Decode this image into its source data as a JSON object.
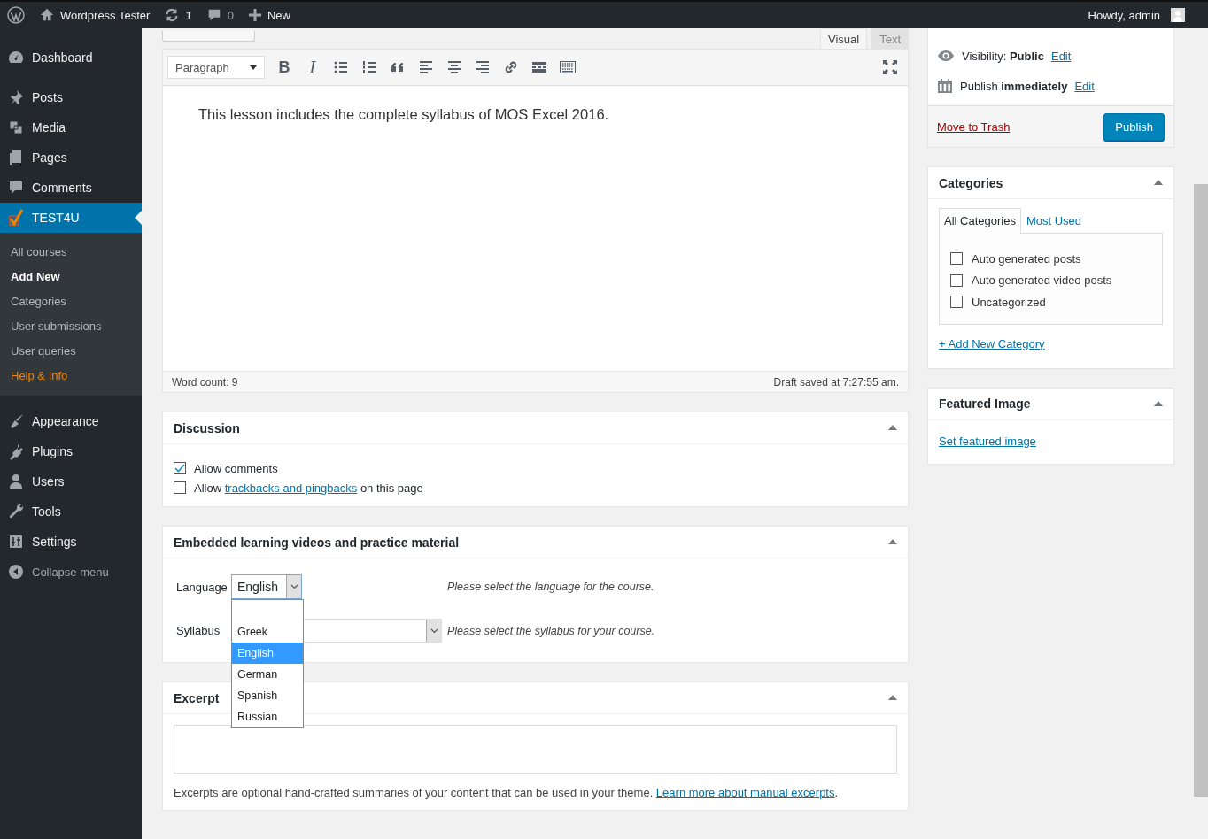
{
  "admin_bar": {
    "site": "Wordpress Tester",
    "updates": "1",
    "comments": "0",
    "new": "New",
    "greeting": "Howdy, admin"
  },
  "sidebar": {
    "items": [
      {
        "label": "Dashboard",
        "selected": false
      },
      {
        "label": "Posts",
        "selected": false
      },
      {
        "label": "Media",
        "selected": false
      },
      {
        "label": "Pages",
        "selected": false
      },
      {
        "label": "Comments",
        "selected": false
      },
      {
        "label": "TEST4U",
        "selected": true,
        "children": [
          {
            "label": "All courses",
            "kind": "link",
            "selected": false
          },
          {
            "label": "Add New",
            "kind": "link",
            "selected": true
          },
          {
            "label": "Categories",
            "kind": "link",
            "selected": false
          },
          {
            "label": "User submissions",
            "kind": "link",
            "selected": false
          },
          {
            "label": "User queries",
            "kind": "link",
            "selected": false
          },
          {
            "label": "Help & Info",
            "kind": "highlight",
            "selected": false
          }
        ]
      },
      {
        "label": "Appearance",
        "selected": false
      },
      {
        "label": "Plugins",
        "selected": false
      },
      {
        "label": "Users",
        "selected": false
      },
      {
        "label": "Tools",
        "selected": false
      },
      {
        "label": "Settings",
        "selected": false
      }
    ],
    "collapse": "Collapse menu"
  },
  "editor": {
    "tabs": [
      {
        "label": "Visual",
        "selected": true
      },
      {
        "label": "Text",
        "selected": false
      }
    ],
    "format": "Paragraph",
    "toolbar": [
      {
        "kind": "bold",
        "text": "B"
      },
      {
        "kind": "italic",
        "text": "I"
      },
      {
        "kind": "bullets"
      },
      {
        "kind": "numbers"
      },
      {
        "kind": "quote"
      },
      {
        "kind": "align-left"
      },
      {
        "kind": "align-center"
      },
      {
        "kind": "align-right"
      },
      {
        "kind": "link"
      },
      {
        "kind": "more"
      },
      {
        "kind": "keyboard"
      }
    ],
    "content": "This lesson includes the complete syllabus of MOS Excel 2016.",
    "word_count": "Word count: 9",
    "draft_status": "Draft saved at 7:27:55 am."
  },
  "discussion": {
    "title": "Discussion",
    "options": [
      {
        "before": "Allow comments",
        "checked": true
      },
      {
        "before": "Allow ",
        "link": "trackbacks and pingbacks",
        "after": " on this page",
        "checked": false
      }
    ]
  },
  "embedded": {
    "title": "Embedded learning videos and practice material",
    "language": {
      "label": "Language",
      "value": "English",
      "hint": "Please select the language for the course.",
      "expanded": true,
      "options": [
        {
          "label": "Greek",
          "selected": false
        },
        {
          "label": "English",
          "selected": true
        },
        {
          "label": "German",
          "selected": false
        },
        {
          "label": "Spanish",
          "selected": false
        },
        {
          "label": "Russian",
          "selected": false
        }
      ]
    },
    "syllabus": {
      "label": "Syllabus",
      "hint": "Please select the syllabus for your course."
    }
  },
  "excerpt": {
    "title": "Excerpt",
    "note_before": "Excerpts are optional hand-crafted summaries of your content that can be used in your theme. ",
    "link": "Learn more about manual excerpts",
    "note_after": "."
  },
  "publish": {
    "visibility": "Visibility: **Public**",
    "schedule": "Publish **immediately**",
    "edit": [
      "Edit",
      "Edit"
    ],
    "trash": "Move to Trash",
    "button": "Publish"
  },
  "categories": {
    "title": "Categories",
    "tabs": [
      {
        "label": "All Categories",
        "selected": true
      },
      {
        "label": "Most Used",
        "selected": false
      }
    ],
    "items": [
      {
        "label": "Auto generated posts",
        "checked": false
      },
      {
        "label": "Auto generated video posts",
        "checked": false
      },
      {
        "label": "Uncategorized",
        "checked": false
      }
    ],
    "add_link": "+ Add New Category"
  },
  "featured_image": {
    "title": "Featured Image",
    "link": "Set featured image"
  }
}
